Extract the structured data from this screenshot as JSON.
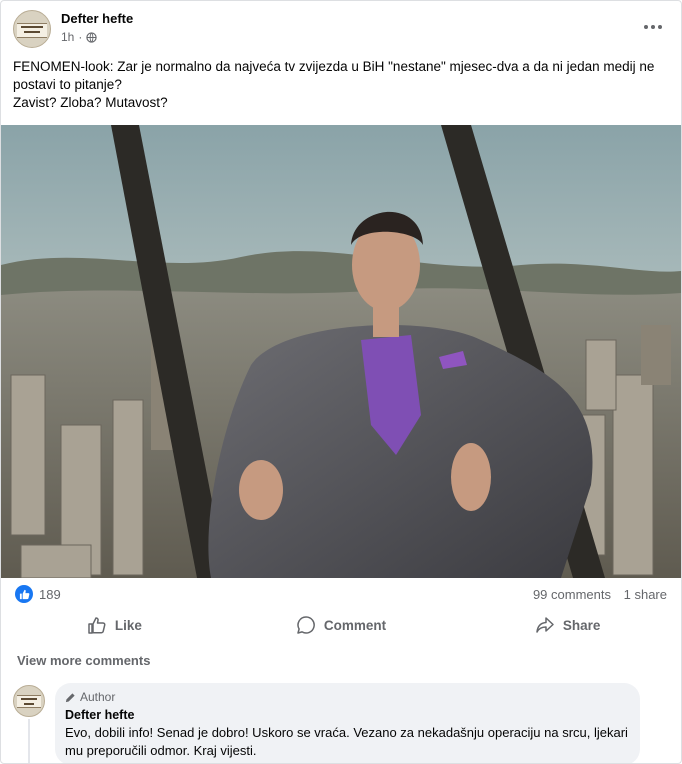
{
  "post": {
    "page_name": "Defter hefte",
    "time": "1h",
    "audience_icon": "globe-icon",
    "more_icon": "more-icon",
    "text_line1": "FENOMEN-look: Zar je normalno da najveća tv zvijezda u BiH \"nestane\" mjesec-dva a da ni jedan medij ne postavi to pitanje?",
    "text_line2": "Zavist? Zloba? Mutavost?"
  },
  "stats": {
    "reactions": "189",
    "comments": "99 comments",
    "shares": "1 share",
    "reaction_icon": "like-icon"
  },
  "actions": {
    "like": "Like",
    "comment": "Comment",
    "share": "Share"
  },
  "comments_section": {
    "view_more": "View more comments",
    "comment": {
      "badge": "Author",
      "badge_icon": "pencil-icon",
      "name": "Defter hefte",
      "text": "Evo, dobili info! Senad je dobro! Uskoro se vraća. Vezano za nekadašnju operaciju na srcu, ljekari mu preporučili odmor. Kraj vijesti."
    }
  },
  "colors": {
    "accent": "#1877f2",
    "secondary_text": "#65676b",
    "bubble_bg": "#f0f2f5"
  }
}
